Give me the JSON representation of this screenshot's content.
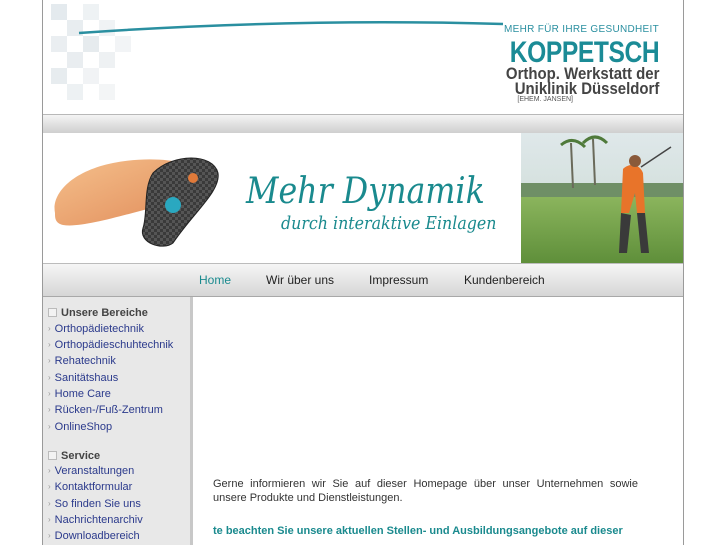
{
  "header": {
    "tagline": "MEHR FÜR IHRE GESUNDHEIT",
    "brand": "KOPPETSCH",
    "subtitle_line1": "Orthop. Werkstatt der",
    "subtitle_line2": "Uniklinik Düsseldorf",
    "former_name": "[EHEM. JANSEN]"
  },
  "banner": {
    "title": "Mehr Dynamik",
    "subtitle": "durch interaktive Einlagen"
  },
  "nav": {
    "items": [
      {
        "label": "Home",
        "active": true
      },
      {
        "label": "Wir über uns",
        "active": false
      },
      {
        "label": "Impressum",
        "active": false
      },
      {
        "label": "Kundenbereich",
        "active": false
      }
    ]
  },
  "sidebar": {
    "sections": [
      {
        "title": "Unsere Bereiche",
        "items": [
          "Orthopädietechnik",
          "Orthopädieschuhtechnik",
          "Rehatechnik",
          "Sanitätshaus",
          "Home Care",
          "Rücken-/Fuß-Zentrum",
          "OnlineShop"
        ]
      },
      {
        "title": "Service",
        "items": [
          "Veranstaltungen",
          "Kontaktformular",
          "So finden Sie uns",
          "Nachrichtenarchiv",
          "Downloadbereich"
        ]
      }
    ]
  },
  "main": {
    "intro": "Gerne informieren wir Sie auf dieser Homepage über unser Unternehmen sowie unsere Produkte und Dienstleistungen.",
    "notice": "te beachten Sie unsere aktuellen Stellen- und Ausbildungsangebote auf dieser S"
  },
  "colors": {
    "accent": "#1a8a8e",
    "link": "#2b3a8c",
    "sidebar_bg": "#e8e8e8"
  }
}
